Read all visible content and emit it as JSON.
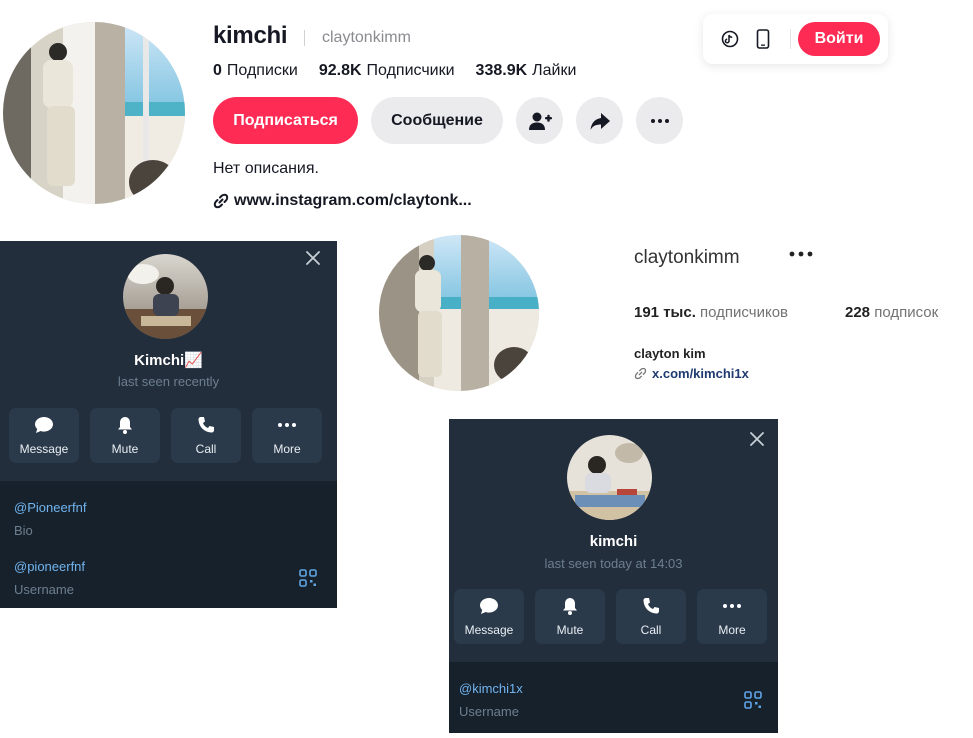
{
  "tiktok": {
    "display_name": "kimchi",
    "username": "claytonkimm",
    "stats": [
      {
        "value": "0",
        "label": "Подписки"
      },
      {
        "value": "92.8K",
        "label": "Подписчики"
      },
      {
        "value": "338.9K",
        "label": "Лайки"
      }
    ],
    "follow_label": "Подписаться",
    "message_label": "Сообщение",
    "bio": "Нет описания.",
    "link": "www.instagram.com/claytonk...",
    "login_label": "Войти",
    "icons": [
      "tiktok-icon",
      "mobile-icon",
      "add-friend-icon",
      "share-icon",
      "more-icon",
      "link-icon"
    ],
    "colors": {
      "primary": "#fe2c55",
      "secondary_bg": "#ebebed"
    }
  },
  "telegram_1": {
    "name": "Kimchi📈",
    "status": "last seen recently",
    "actions": [
      {
        "label": "Message",
        "icon": "message-icon"
      },
      {
        "label": "Mute",
        "icon": "bell-icon"
      },
      {
        "label": "Call",
        "icon": "phone-icon"
      },
      {
        "label": "More",
        "icon": "more-icon"
      }
    ],
    "bio_value": "@Pioneerfnf",
    "bio_label": "Bio",
    "username_value": "@pioneerfnf",
    "username_label": "Username"
  },
  "instagram": {
    "username": "claytonkimm",
    "followers_num": "191 тыс.",
    "followers_label": "подписчиков",
    "following_num": "228",
    "following_label": "подписок",
    "full_name": "clayton kim",
    "link": "x.com/kimchi1x"
  },
  "telegram_2": {
    "name": "kimchi",
    "status": "last seen today at 14:03",
    "actions": [
      {
        "label": "Message",
        "icon": "message-icon"
      },
      {
        "label": "Mute",
        "icon": "bell-icon"
      },
      {
        "label": "Call",
        "icon": "phone-icon"
      },
      {
        "label": "More",
        "icon": "more-icon"
      }
    ],
    "username_value": "@kimchi1x",
    "username_label": "Username"
  },
  "colors": {
    "telegram_bg": "#17212b",
    "telegram_header": "#232e3c",
    "telegram_link": "#71b4ef"
  }
}
